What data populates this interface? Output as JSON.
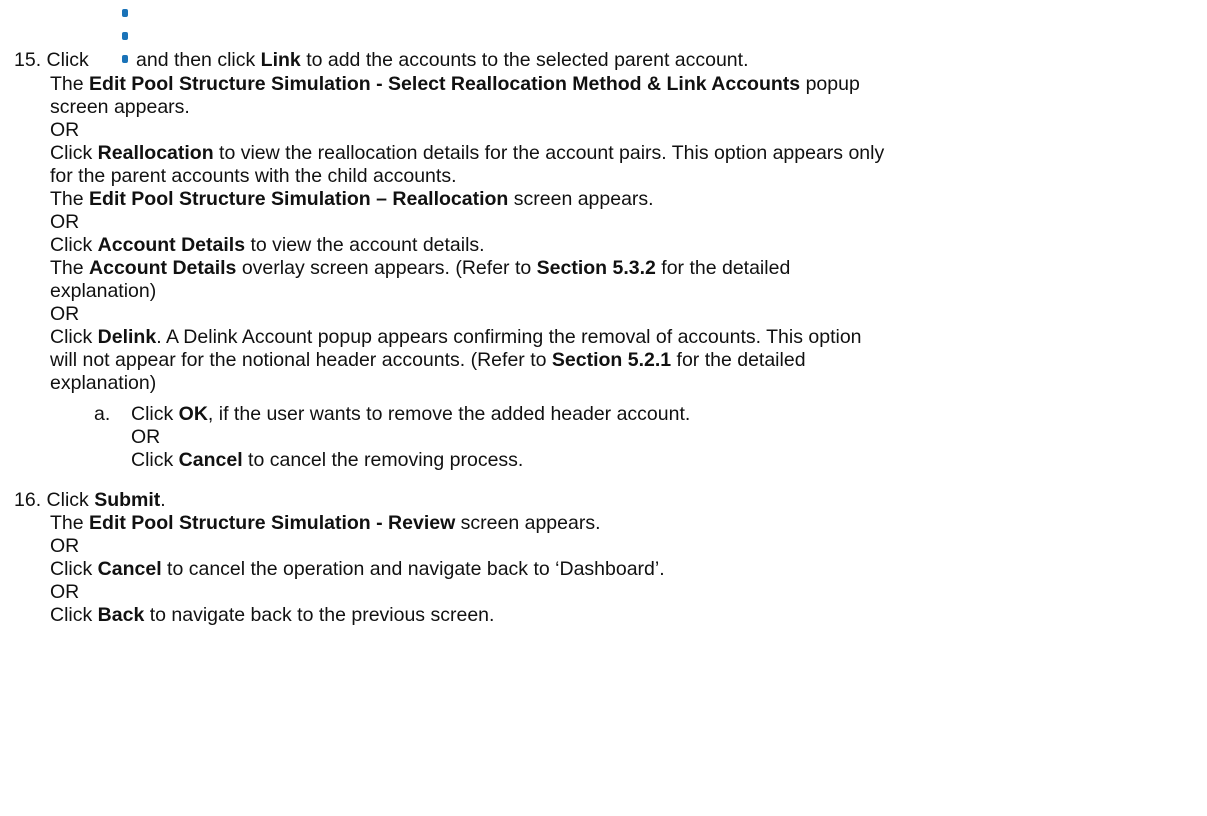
{
  "step15": {
    "number": "15.",
    "icon": "kebab-menu-icon",
    "accent_color": "#1a73b8",
    "click_word": "Click",
    "intro_tail": "and then click",
    "link_label": "Link",
    "intro_end": "to add the accounts to the selected parent account.",
    "link_result_prefix": "The",
    "link_result_screen": "Edit Pool Structure Simulation - Select Reallocation Method & Link Accounts",
    "link_result_suffix": "popup",
    "link_result_line2": "screen appears.",
    "or": "OR",
    "reallocation_label": "Reallocation",
    "reallocation_desc": "to view the reallocation details for the account pairs. This option appears only",
    "reallocation_desc2": "for the parent accounts with the child accounts.",
    "reallocation_result_screen": "Edit Pool Structure Simulation – Reallocation",
    "reallocation_result_suffix": "screen appears.",
    "account_details_label": "Account Details",
    "account_details_desc": "to view the account details.",
    "account_details_result_screen": "Account Details",
    "account_details_result_suffix": "overlay screen appears. (Refer to",
    "account_details_section": "Section 5.3.2",
    "account_details_tail": "for the detailed",
    "explanation": "explanation)",
    "delink_label": "Delink",
    "delink_desc": ". A Delink Account popup appears confirming the removal of accounts. This option",
    "delink_desc2": "will not appear for the notional header accounts. (Refer to",
    "delink_section": "Section 5.2.1",
    "delink_tail": "for the detailed",
    "sub_a": {
      "letter": "a.",
      "ok_label": "OK",
      "ok_desc": ", if the user wants to remove the added header account.",
      "cancel_label": "Cancel",
      "cancel_desc": "to cancel the removing process."
    }
  },
  "step16": {
    "number": "16.",
    "submit_label": "Submit",
    "submit_result_screen": "Edit Pool Structure Simulation - Review",
    "submit_result_suffix": "screen appears.",
    "cancel_label": "Cancel",
    "cancel_desc": "to cancel the operation and navigate back to ‘Dashboard’.",
    "back_label": "Back",
    "back_desc": "to navigate back to the previous screen."
  }
}
